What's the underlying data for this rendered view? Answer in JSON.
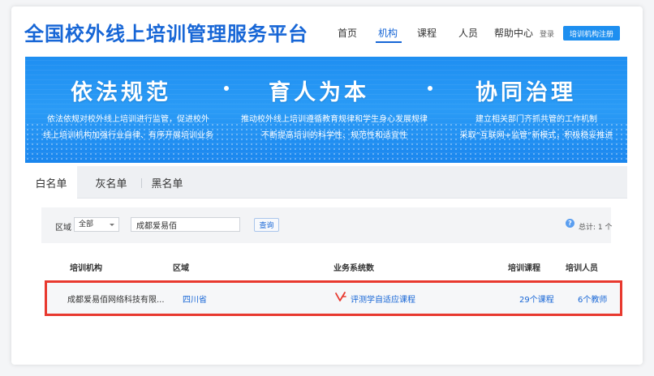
{
  "header": {
    "logo": "全国校外线上培训管理服务平台",
    "nav": [
      "首页",
      "机构",
      "课程",
      "人员",
      "帮助中心"
    ],
    "active_nav": "机构",
    "login": "登录",
    "register": "培训机构注册"
  },
  "banner": {
    "sections": [
      {
        "title": "依法规范",
        "lines": [
          "依法依规对校外线上培训进行监管，促进校外",
          "线上培训机构加强行业自律、有序开展培训业务"
        ]
      },
      {
        "title": "育人为本",
        "lines": [
          "推动校外线上培训遵循教育规律和学生身心发展规律",
          "不断提高培训的科学性、规范性和适宜性"
        ]
      },
      {
        "title": "协同治理",
        "lines": [
          "建立相关部门齐抓共管的工作机制",
          "采取“互联网+监管”新模式，积极稳妥推进"
        ]
      }
    ]
  },
  "tabs": [
    "白名单",
    "灰名单",
    "黑名单"
  ],
  "filter": {
    "region_label": "区域",
    "region_value": "全部",
    "search_value": "成都爱易佰",
    "search_button": "查询",
    "total": "总计: 1 个"
  },
  "table": {
    "columns": [
      "培训机构",
      "区域",
      "业务系统数",
      "培训课程",
      "培训人员"
    ],
    "rows": [
      {
        "org": "成都爱易佰网络科技有限...",
        "region": "四川省",
        "system": "评测学自适应课程",
        "courses": "29个课程",
        "staff": "6个教师"
      }
    ]
  },
  "colors": {
    "brand": "#1766d6",
    "banner": "#1f8ff1",
    "highlight": "#e8392f"
  }
}
